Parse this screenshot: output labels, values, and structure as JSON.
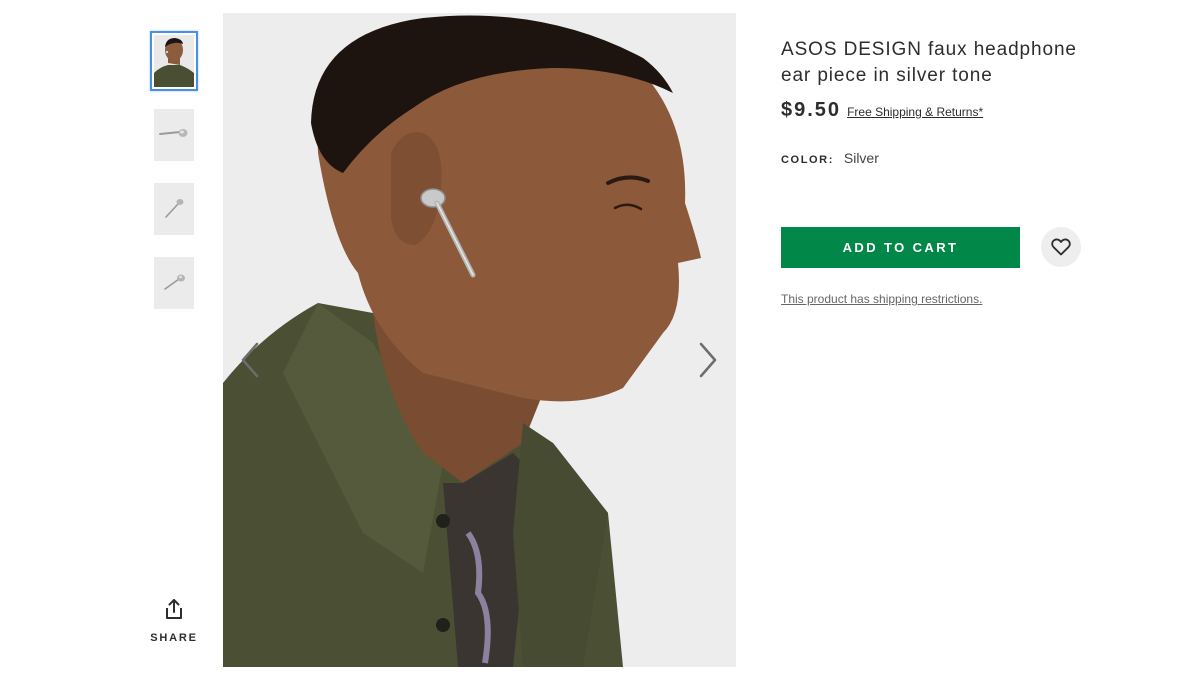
{
  "gallery": {
    "thumbnails": [
      {
        "label": "model-wearing-ear-piece",
        "active": true
      },
      {
        "label": "ear-piece-side-view",
        "active": false
      },
      {
        "label": "ear-piece-angled-view",
        "active": false
      },
      {
        "label": "ear-piece-detail-view",
        "active": false
      }
    ],
    "share_label": "SHARE",
    "prev_icon": "chevron-left-icon",
    "next_icon": "chevron-right-icon"
  },
  "product": {
    "title": "ASOS DESIGN faux headphone ear piece in silver tone",
    "price": "$9.50",
    "shipping_link": "Free Shipping & Returns*",
    "color_label": "COLOR:",
    "color_value": "Silver",
    "add_to_cart_label": "ADD TO CART",
    "save_icon": "heart-icon",
    "restriction_note": "This product has shipping restrictions."
  },
  "colors": {
    "add_to_cart_bg": "#018849",
    "active_thumb_border": "#4a90e2",
    "text": "#2d2d2d",
    "image_bg": "#ededed"
  }
}
